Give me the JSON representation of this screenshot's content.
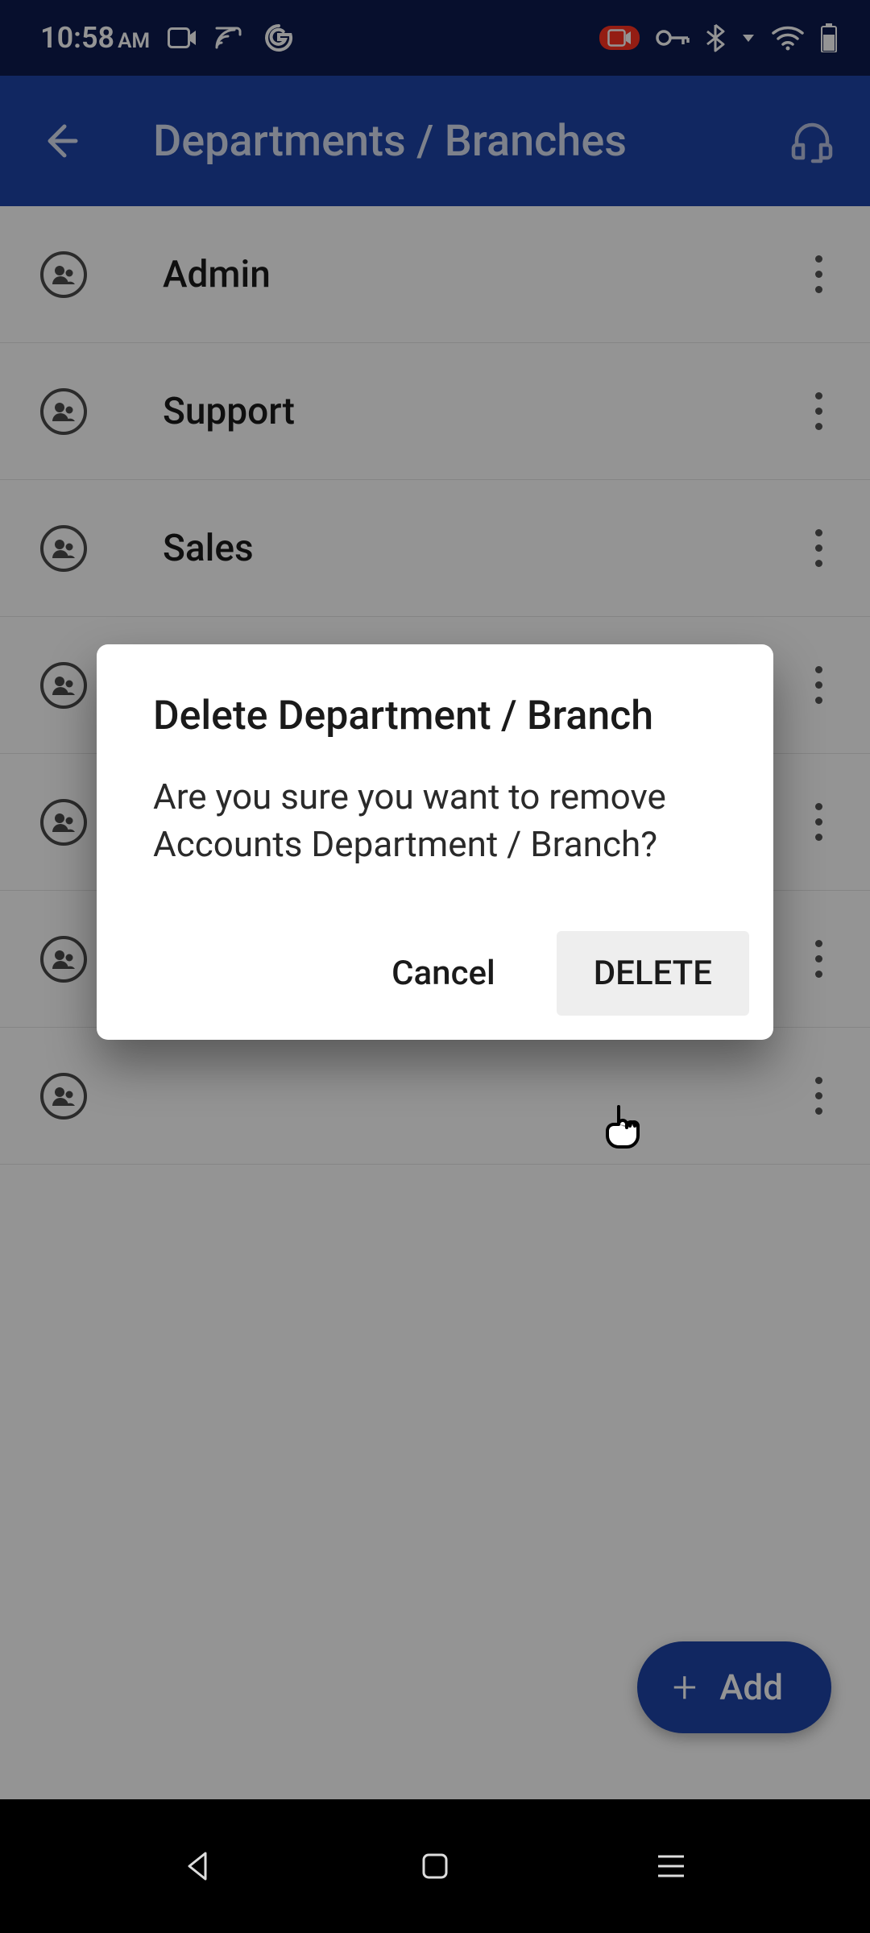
{
  "status": {
    "time": "10:58",
    "ampm": "AM"
  },
  "header": {
    "title": "Departments / Branches"
  },
  "departments": {
    "items": [
      {
        "label": "Admin"
      },
      {
        "label": "Support"
      },
      {
        "label": "Sales"
      },
      {
        "label": ""
      },
      {
        "label": ""
      },
      {
        "label": ""
      },
      {
        "label": ""
      }
    ]
  },
  "fab": {
    "label": "Add"
  },
  "dialog": {
    "title": "Delete Department / Branch",
    "body": "Are you sure you want to remove Accounts Department / Branch?",
    "cancel": "Cancel",
    "confirm": "DELETE"
  }
}
